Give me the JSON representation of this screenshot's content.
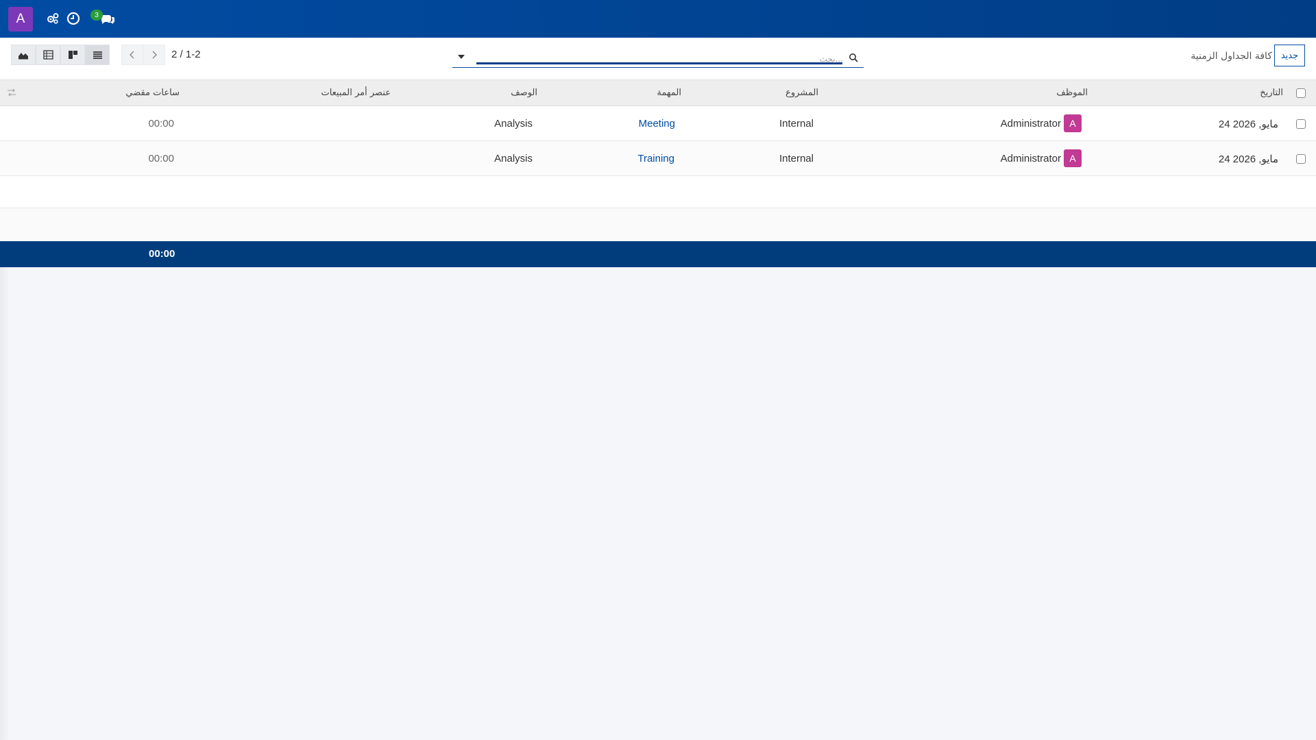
{
  "navbar": {
    "user_initial": "A",
    "chat_badge_count": "3",
    "icons": [
      "activity-icon",
      "clock-icon",
      "chat-icon"
    ],
    "colors": {
      "bg": "#014ca3",
      "avatar": "#7b39b8",
      "badge": "#2a9d3a"
    }
  },
  "control_panel": {
    "new_button_label": "جديد",
    "breadcrumb": "كافة الجداول الزمنية",
    "search_placeholder": "بحث...",
    "pager_text": "1-2 / 2",
    "view_switcher": [
      "list-view",
      "kanban-view",
      "pivot-view",
      "graph-view"
    ]
  },
  "table": {
    "columns": [
      "التاريخ",
      "الموظف",
      "المشروع",
      "المهمة",
      "الوصف",
      "عنصر أمر المبيعات",
      "ساعات مقضي"
    ],
    "rows": [
      {
        "date": "24 مايو, 2026",
        "employee_initial": "A",
        "employee": "Administrator",
        "project": "Internal",
        "task": "Meeting",
        "description": "Analysis",
        "sales_item": "",
        "hours": "00:00"
      },
      {
        "date": "24 مايو, 2026",
        "employee_initial": "A",
        "employee": "Administrator",
        "project": "Internal",
        "task": "Training",
        "description": "Analysis",
        "sales_item": "",
        "hours": "00:00"
      }
    ],
    "footer_total": "00:00"
  }
}
